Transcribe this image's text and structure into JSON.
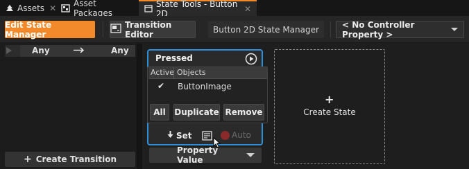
{
  "tabs": [
    {
      "label": "Assets",
      "icon": "tree-icon",
      "closable": true
    },
    {
      "label": "Asset Packages",
      "icon": "package-icon",
      "closable": false
    },
    {
      "label": "State Tools - Button 2D",
      "icon": "window-icon",
      "closable": true,
      "active": true
    }
  ],
  "toolbar": {
    "edit_state_manager": "Edit State Manager",
    "transition_editor": "Transition Editor",
    "state_manager_name": "Button 2D State Manager",
    "controller_property": "< No Controller Property >"
  },
  "transitions": {
    "from": "Any",
    "to": "Any",
    "create_label": "Create Transition"
  },
  "state": {
    "name": "Pressed",
    "set_label": "Set",
    "auto_label": "Auto",
    "property_value_label": "Property Value"
  },
  "popup": {
    "col_active": "Active",
    "col_objects": "Objects",
    "rows": [
      {
        "active": true,
        "name": "ButtonImage"
      }
    ],
    "all_label": "All",
    "duplicate_label": "Duplicate",
    "remove_label": "Remove"
  },
  "create_state": {
    "label": "Create State"
  },
  "colors": {
    "accent": "#f28a2c",
    "selection": "#2f8fd8"
  }
}
